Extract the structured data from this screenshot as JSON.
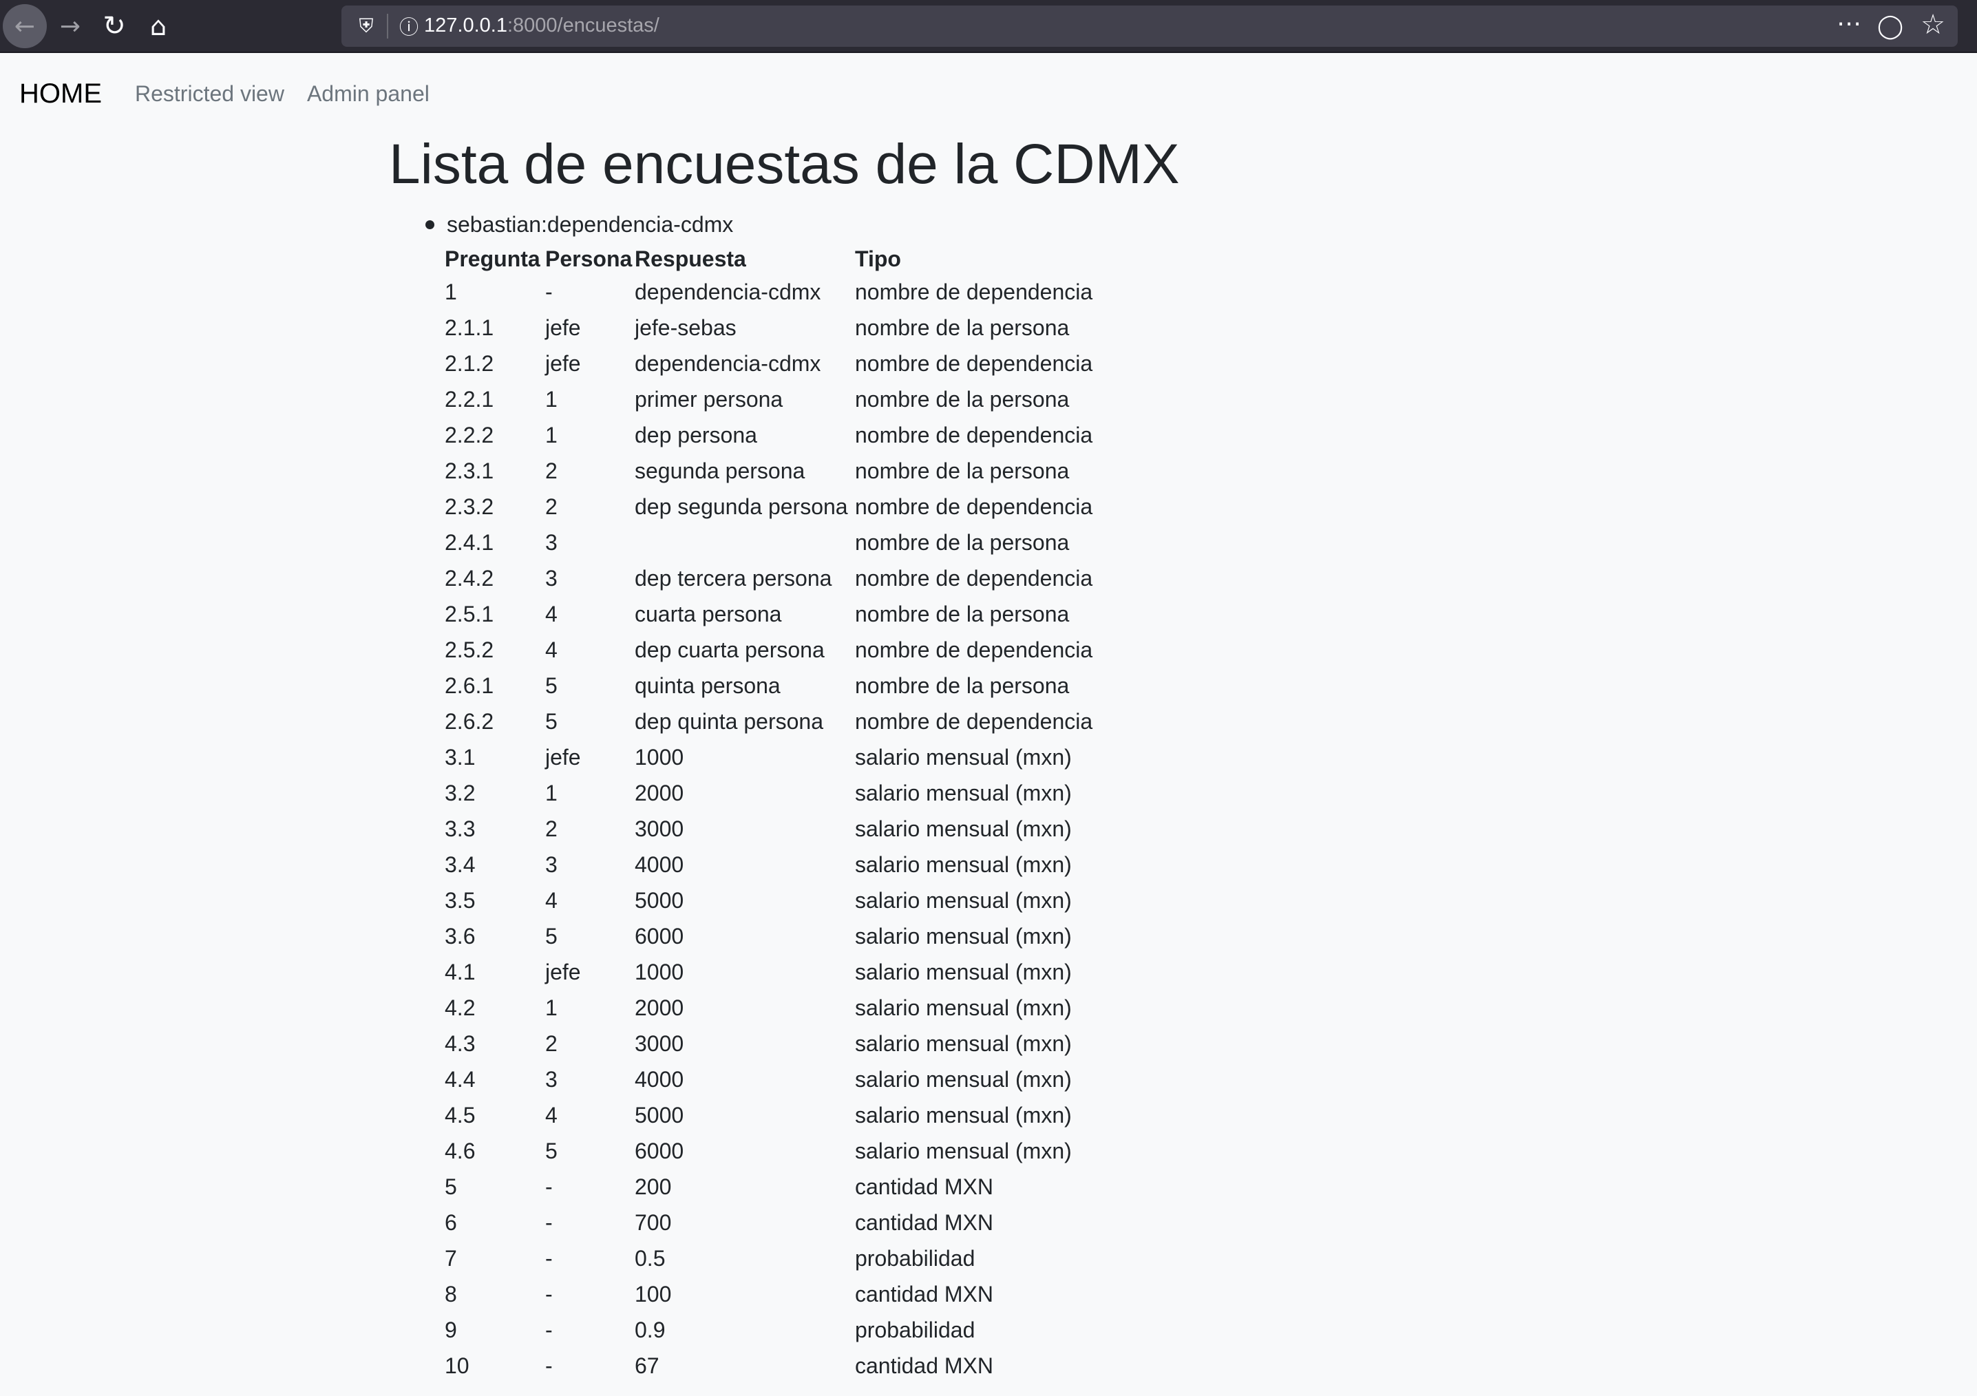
{
  "browser": {
    "url_host": "127.0.0.1",
    "url_path": ":8000/encuestas/",
    "icons": [
      "back-arrow-icon",
      "forward-arrow-icon",
      "reload-icon",
      "home-icon",
      "shield-icon",
      "info-icon",
      "more-icon",
      "pocket-icon",
      "star-icon"
    ]
  },
  "navbar": {
    "brand": "HOME",
    "links": [
      "Restricted view",
      "Admin panel"
    ]
  },
  "page": {
    "title": "Lista de encuestas de la CDMX"
  },
  "survey": {
    "label": "sebastian:dependencia-cdmx",
    "headers": [
      "Pregunta",
      "Persona",
      "Respuesta",
      "Tipo"
    ],
    "rows": [
      [
        "1",
        "-",
        "dependencia-cdmx",
        "nombre de dependencia"
      ],
      [
        "2.1.1",
        "jefe",
        "jefe-sebas",
        "nombre de la persona"
      ],
      [
        "2.1.2",
        "jefe",
        "dependencia-cdmx",
        "nombre de dependencia"
      ],
      [
        "2.2.1",
        "1",
        "primer persona",
        "nombre de la persona"
      ],
      [
        "2.2.2",
        "1",
        "dep persona",
        "nombre de dependencia"
      ],
      [
        "2.3.1",
        "2",
        "segunda persona",
        "nombre de la persona"
      ],
      [
        "2.3.2",
        "2",
        "dep segunda persona",
        "nombre de dependencia"
      ],
      [
        "2.4.1",
        "3",
        "",
        "nombre de la persona"
      ],
      [
        "2.4.2",
        "3",
        "dep tercera persona",
        "nombre de dependencia"
      ],
      [
        "2.5.1",
        "4",
        "cuarta persona",
        "nombre de la persona"
      ],
      [
        "2.5.2",
        "4",
        "dep cuarta persona",
        "nombre de dependencia"
      ],
      [
        "2.6.1",
        "5",
        "quinta persona",
        "nombre de la persona"
      ],
      [
        "2.6.2",
        "5",
        "dep quinta persona",
        "nombre de dependencia"
      ],
      [
        "3.1",
        "jefe",
        "1000",
        "salario mensual (mxn)"
      ],
      [
        "3.2",
        "1",
        "2000",
        "salario mensual (mxn)"
      ],
      [
        "3.3",
        "2",
        "3000",
        "salario mensual (mxn)"
      ],
      [
        "3.4",
        "3",
        "4000",
        "salario mensual (mxn)"
      ],
      [
        "3.5",
        "4",
        "5000",
        "salario mensual (mxn)"
      ],
      [
        "3.6",
        "5",
        "6000",
        "salario mensual (mxn)"
      ],
      [
        "4.1",
        "jefe",
        "1000",
        "salario mensual (mxn)"
      ],
      [
        "4.2",
        "1",
        "2000",
        "salario mensual (mxn)"
      ],
      [
        "4.3",
        "2",
        "3000",
        "salario mensual (mxn)"
      ],
      [
        "4.4",
        "3",
        "4000",
        "salario mensual (mxn)"
      ],
      [
        "4.5",
        "4",
        "5000",
        "salario mensual (mxn)"
      ],
      [
        "4.6",
        "5",
        "6000",
        "salario mensual (mxn)"
      ],
      [
        "5",
        "-",
        "200",
        "cantidad MXN"
      ],
      [
        "6",
        "-",
        "700",
        "cantidad MXN"
      ],
      [
        "7",
        "-",
        "0.5",
        "probabilidad"
      ],
      [
        "8",
        "-",
        "100",
        "cantidad MXN"
      ],
      [
        "9",
        "-",
        "0.9",
        "probabilidad"
      ],
      [
        "10",
        "-",
        "67",
        "cantidad MXN"
      ]
    ]
  }
}
